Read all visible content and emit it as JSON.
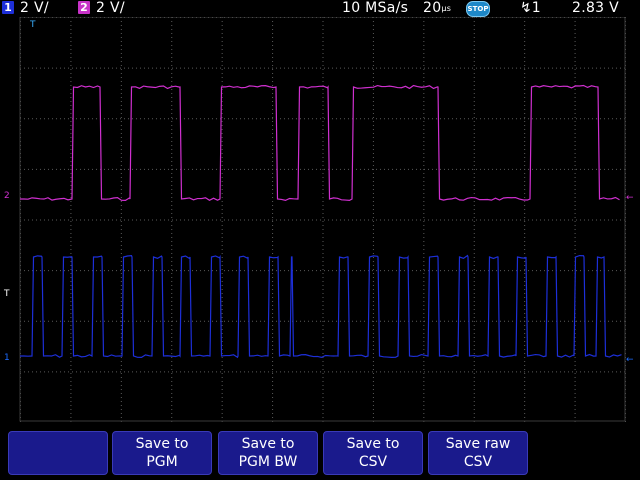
{
  "topbar": {
    "ch1_badge": "1",
    "ch1_scale": "2 V/",
    "ch2_badge": "2",
    "ch2_scale": "2 V/",
    "sample_rate": "10 MSa/s",
    "timebase": "20",
    "timebase_unit": "µs",
    "run_state": "STOP",
    "trigger_channel": "1",
    "trigger_level": "2.83 V"
  },
  "markers": {
    "trigger_top": "T",
    "ch2_ref": "2",
    "ch1_ref": "1",
    "trigger_level_marker": "T"
  },
  "menu": {
    "keys": [
      {
        "line1": "",
        "line2": ""
      },
      {
        "line1": "Save to",
        "line2": "PGM"
      },
      {
        "line1": "Save to",
        "line2": "PGM BW"
      },
      {
        "line1": "Save to",
        "line2": "CSV"
      },
      {
        "line1": "Save raw",
        "line2": "CSV"
      }
    ]
  },
  "colors": {
    "ch1": "#1d2fd8",
    "ch2": "#d030d0",
    "softkey": "#1a1a8c",
    "grid": "#5a5a5a"
  },
  "traces": {
    "ch1_transitions": [
      32,
      42,
      62,
      72,
      92,
      102,
      122,
      132,
      152,
      162,
      180,
      190,
      210,
      220,
      238,
      248,
      268,
      278,
      290,
      292,
      338,
      348,
      368,
      378,
      398,
      408,
      428,
      438,
      458,
      468,
      488,
      498,
      516,
      526,
      546,
      556,
      574,
      584,
      596,
      604
    ],
    "ch2_transitions": [
      72,
      100,
      130,
      180,
      220,
      276,
      298,
      328,
      352,
      438,
      530,
      598
    ]
  }
}
